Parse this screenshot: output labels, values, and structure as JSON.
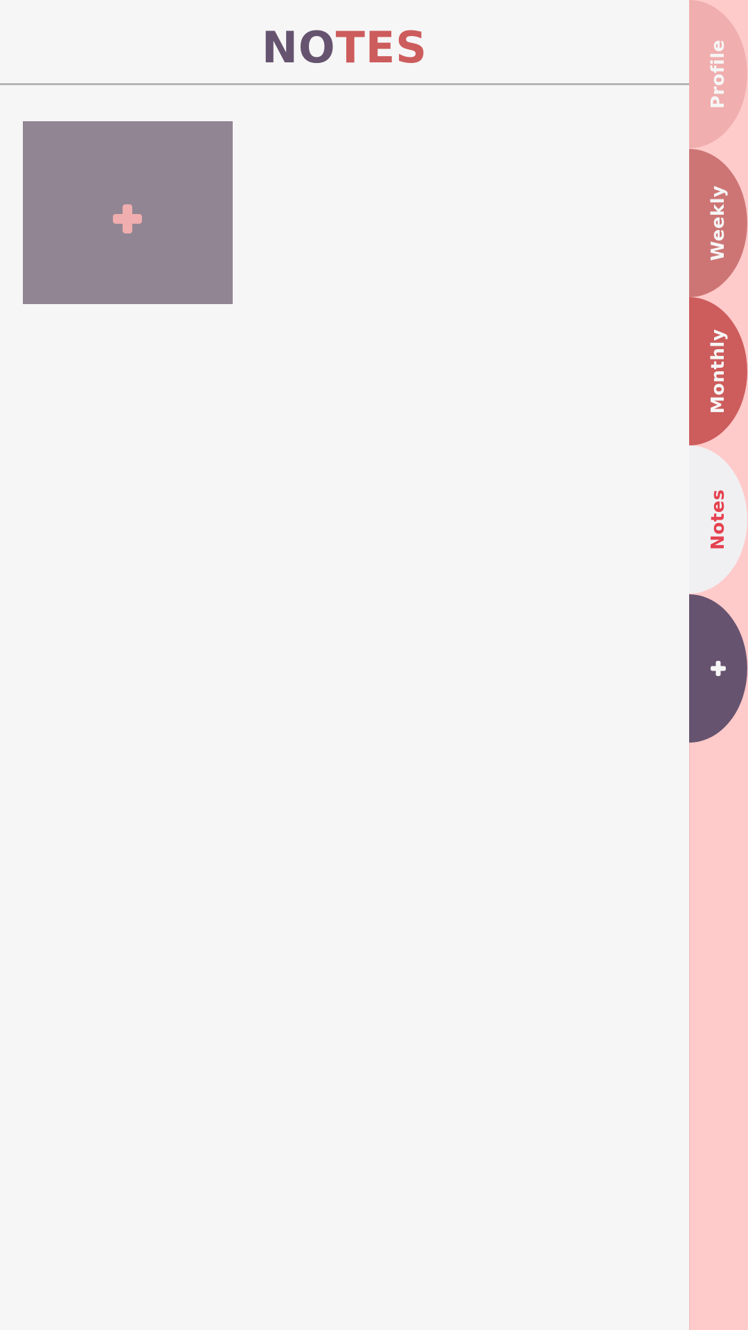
{
  "header": {
    "title_segments": [
      {
        "text": "NO",
        "color": "#66536f"
      },
      {
        "text": "TES",
        "color": "#cd5c5c"
      }
    ]
  },
  "notes_grid": {
    "add_card": {
      "icon": "plus-icon",
      "background": "#928593",
      "icon_color": "#f0aeae"
    }
  },
  "sidebar": {
    "background": "#ffcaca",
    "tabs": [
      {
        "id": "profile",
        "label": "Profile",
        "background": "#f0aeae",
        "text_color": "#f6f6f6",
        "active": false
      },
      {
        "id": "weekly",
        "label": "Weekly",
        "background": "#cd7575",
        "text_color": "#f6f6f6",
        "active": false
      },
      {
        "id": "monthly",
        "label": "Monthly",
        "background": "#cd5c5c",
        "text_color": "#f6f6f6",
        "active": false
      },
      {
        "id": "notes",
        "label": "Notes",
        "background": "#f0f0f2",
        "text_color": "#e5414f",
        "active": true
      },
      {
        "id": "add",
        "label": "",
        "icon": "plus-icon",
        "background": "#66536f",
        "icon_color": "#f6f6f6",
        "active": false
      }
    ]
  }
}
